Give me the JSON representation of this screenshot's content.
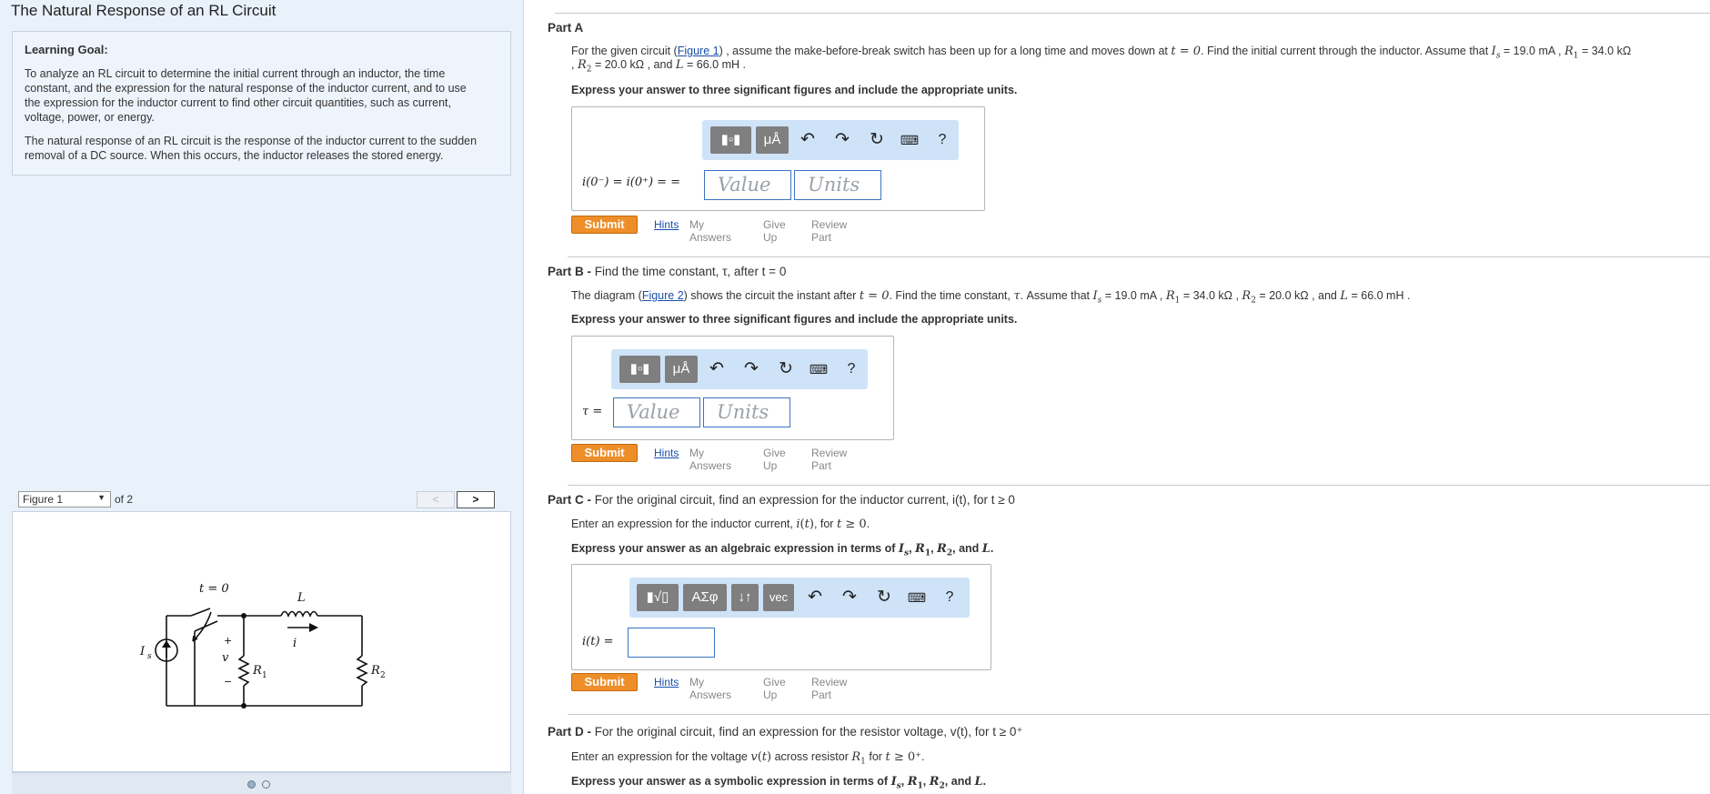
{
  "page_title": "The Natural Response of an RL Circuit",
  "learning_goal": {
    "heading": "Learning Goal:",
    "p1_lines": [
      "To analyze an RL circuit to determine the initial current through an inductor, the time",
      "constant, and the expression for the natural response of the inductor current, and to use",
      "the expression for the inductor current to find other circuit quantities, such as current,",
      "voltage, power, or energy."
    ],
    "p2_lines": [
      "The natural response of an RL circuit is the response of the inductor current to the sudden",
      "removal of a DC source. When this occurs, the inductor releases the stored energy."
    ]
  },
  "figure_nav": {
    "selected": "Figure 1",
    "of_label": "of 2",
    "prev": "<",
    "next": ">"
  },
  "circuit": {
    "switch_label": "t = 0",
    "inductor_label": "L",
    "current_label": "i",
    "source_label": "I",
    "source_sub": "s",
    "voltage_label": "v",
    "plus": "+",
    "minus": "−",
    "r1": "R",
    "r1_sub": "1",
    "r2": "R",
    "r2_sub": "2"
  },
  "toolbar": {
    "templates": "▮▫▮",
    "units": "μÅ",
    "greek": "ΑΣφ",
    "arrows": "↓↑",
    "vec": "vec",
    "undo": "↶",
    "redo": "↷",
    "reset": "↻",
    "keyboard": "⌨",
    "help": "?"
  },
  "actions": {
    "submit": "Submit",
    "hints": "Hints",
    "my_answers": "My Answers",
    "give_up": "Give Up",
    "review": "Review Part"
  },
  "fields": {
    "value_placeholder": "Value",
    "units_placeholder": "Units"
  },
  "part_a": {
    "title": "Part A",
    "q_pre": "For the given circuit (",
    "q_link": "Figure 1",
    "q_post": ") , assume the make-before-break switch has been up for a long time and moves down at",
    "q_t": "t = 0",
    "q_tail": ". Find the initial current through the inductor. Assume that",
    "is_sym": "I",
    "is_val": " = 19.0 mA ,",
    "r1_val": " = 34.0 kΩ",
    "line2_r2_val": " = 20.0 kΩ , and",
    "l_sym": "L",
    "l_val": " = 66.0 mH .",
    "instruction": "Express your answer to three significant figures and include the appropriate units.",
    "eq_label": "i(0⁻) = i(0⁺) = ="
  },
  "part_b": {
    "title_bold": "Part B -",
    "title_rest": " Find the time constant, τ, after t = 0",
    "q_pre": "The diagram (",
    "q_link": "Figure 2",
    "q_post": ") shows the circuit the instant after",
    "q_tail": ". Find the time constant,",
    "q_tail2": ". Assume that",
    "vals": " = 19.0 mA ,",
    "r1_val": " = 34.0 kΩ ,",
    "r2_val": " = 20.0 kΩ , and",
    "l_val": " = 66.0 mH .",
    "instruction": "Express your answer to three significant figures and include the appropriate units.",
    "eq_label": "τ ="
  },
  "part_c": {
    "title_bold": "Part C -",
    "title_rest": " For the original circuit, find an expression for the inductor current, i(t), for t ≥ 0",
    "q_pre": "Enter an expression for the inductor current,",
    "q_mid": ", for",
    "q_end": ".",
    "instruction_pre": "Express your answer as an algebraic expression in terms of",
    "eq_label": "i(t) ="
  },
  "part_d": {
    "title_bold": "Part D -",
    "title_rest": " For the original circuit, find an expression for the resistor voltage, v(t), for t ≥ 0⁺",
    "q_pre": "Enter an expression for the voltage",
    "q_mid": "across resistor",
    "q_end": "for",
    "instruction_pre": "Express your answer as a symbolic expression in terms of"
  }
}
